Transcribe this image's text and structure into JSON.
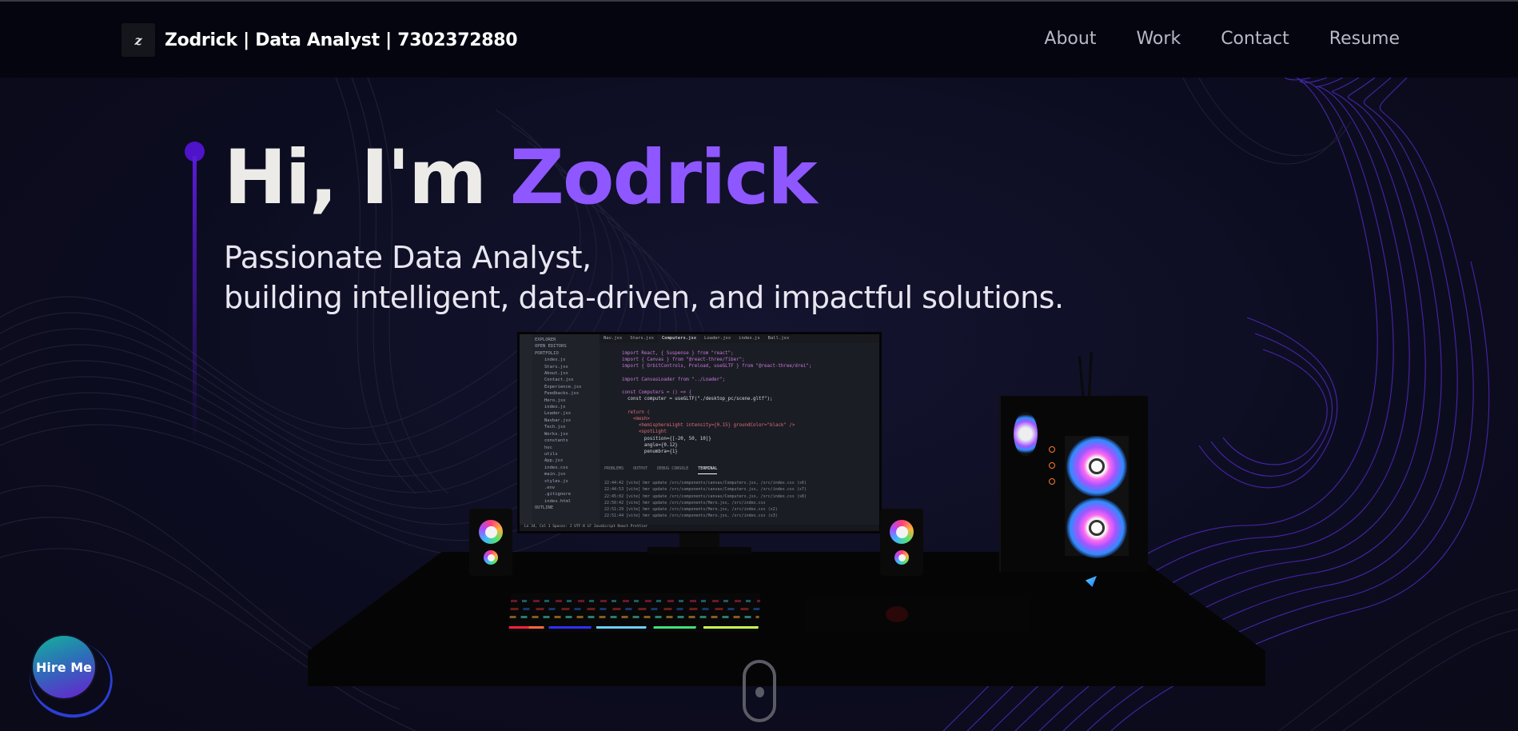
{
  "navbar": {
    "logo_letter": "z",
    "brand": "Zodrick  | Data Analyst | 7302372880",
    "links": [
      {
        "label": "About"
      },
      {
        "label": "Work"
      },
      {
        "label": "Contact"
      },
      {
        "label": "Resume"
      }
    ]
  },
  "hero": {
    "headline_prefix": "Hi, I'm ",
    "headline_name": "Zodrick",
    "subline_1": "Passionate Data Analyst,",
    "subline_2": "building intelligent, data-driven, and impactful solutions."
  },
  "editor": {
    "tabs": [
      "Nav.jsx",
      "Stars.jsx",
      "Computers.jsx",
      "Loader.jsx",
      "index.js",
      "Ball.jsx"
    ],
    "active_tab": "Computers.jsx",
    "explorer_title": "EXPLORER",
    "explorer_items": [
      "OPEN EDITORS",
      "PORTFOLIO",
      "index.js",
      "Stars.jsx",
      "About.jsx",
      "Contact.jsx",
      "Experience.jsx",
      "Feedbacks.jsx",
      "Hero.jsx",
      "index.js",
      "Loader.jsx",
      "Navbar.jsx",
      "Tech.jsx",
      "Works.jsx",
      "constants",
      "hoc",
      "utils",
      "App.jsx",
      "index.css",
      "main.jsx",
      "styles.js",
      ".env",
      ".gitignore",
      "index.html",
      "OUTLINE"
    ],
    "code_lines": [
      "import React, { Suspense } from \"react\";",
      "import { Canvas } from \"@react-three/fiber\";",
      "import { OrbitControls, Preload, useGLTF } from \"@react-three/drei\";",
      "",
      "import CanvasLoader from \"../Loader\";",
      "",
      "const Computers = () => {",
      "  const computer = useGLTF(\"./desktop_pc/scene.gltf\");",
      "",
      "  return (",
      "    <mesh>",
      "      <hemisphereLight intensity={0.15} groundColor=\"black\" />",
      "      <spotLight",
      "        position={[-20, 50, 10]}",
      "        angle={0.12}",
      "        penumbra={1}"
    ],
    "panel_tabs": [
      "PROBLEMS",
      "OUTPUT",
      "DEBUG CONSOLE",
      "TERMINAL"
    ],
    "terminal_lines": [
      "22:44:42 [vite] hmr update /src/components/canvas/Computers.jsx, /src/index.css (x6)",
      "22:44:53 [vite] hmr update /src/components/canvas/Computers.jsx, /src/index.css (x7)",
      "22:45:02 [vite] hmr update /src/components/canvas/Computers.jsx, /src/index.css (x8)",
      "22:50:42 [vite] hmr update /src/components/Hero.jsx, /src/index.css",
      "22:51:29 [vite] hmr update /src/components/Hero.jsx, /src/index.css (x2)",
      "22:51:44 [vite] hmr update /src/components/Hero.jsx, /src/index.css (x3)"
    ],
    "status": "Ln 34, Col 1   Spaces: 2   UTF-8   LF   JavaScript React   Prettier"
  },
  "hire_me": {
    "label": "Hire Me"
  },
  "colors": {
    "accent": "#8e57ff",
    "navbar_bg": "#050510",
    "page_bg": "#0b0b1a",
    "accent_dot": "#4f13c9"
  }
}
